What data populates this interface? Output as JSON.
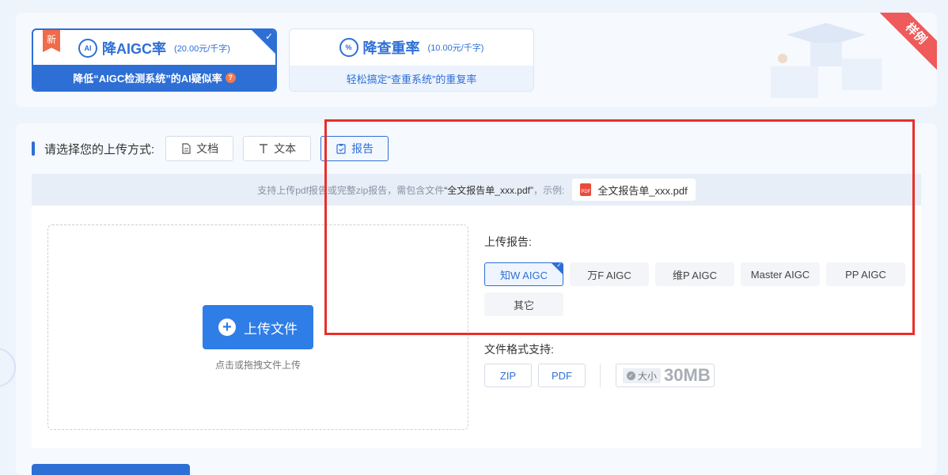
{
  "services": [
    {
      "title": "降AIGC率",
      "price": "(20.00元/千字)",
      "subtitle": "降低“AIGC检测系统”的AI疑似率",
      "icon": "ai-icon",
      "badge": "新",
      "help_icon": "?",
      "selected": true
    },
    {
      "title": "降查重率",
      "price": "(10.00元/千字)",
      "subtitle": "轻松搞定“查重系统”的重复率",
      "icon": "percent-icon",
      "selected": false
    }
  ],
  "ribbon": "样例",
  "upload_method": {
    "label": "请选择您的上传方式:",
    "options": [
      {
        "label": "文档",
        "icon": "document-icon"
      },
      {
        "label": "文本",
        "icon": "text-icon"
      },
      {
        "label": "报告",
        "icon": "report-icon",
        "active": true
      }
    ]
  },
  "tip": {
    "text_prefix": "支持上传pdf报告或完整zip报告，需包含文件",
    "filename": "“全文报告单_xxx.pdf”",
    "text_suffix": "，示例:",
    "example_file": "全文报告单_xxx.pdf",
    "pdf_icon_text": "PDF"
  },
  "upload": {
    "button_label": "上传文件",
    "hint": "点击或拖拽文件上传"
  },
  "report_source": {
    "label": "上传报告:",
    "options": [
      "知W AIGC",
      "万F AIGC",
      "维P AIGC",
      "Master AIGC",
      "PP AIGC",
      "其它"
    ],
    "selected_index": 0
  },
  "formats": {
    "label": "文件格式支持:",
    "items": [
      "ZIP",
      "PDF"
    ],
    "size_label": "大小",
    "size_value": "30MB"
  },
  "colors": {
    "accent": "#2e6fd6",
    "highlight_box": "#e8302a",
    "ribbon": "#ef5a5a",
    "badge": "#f06b4a"
  }
}
